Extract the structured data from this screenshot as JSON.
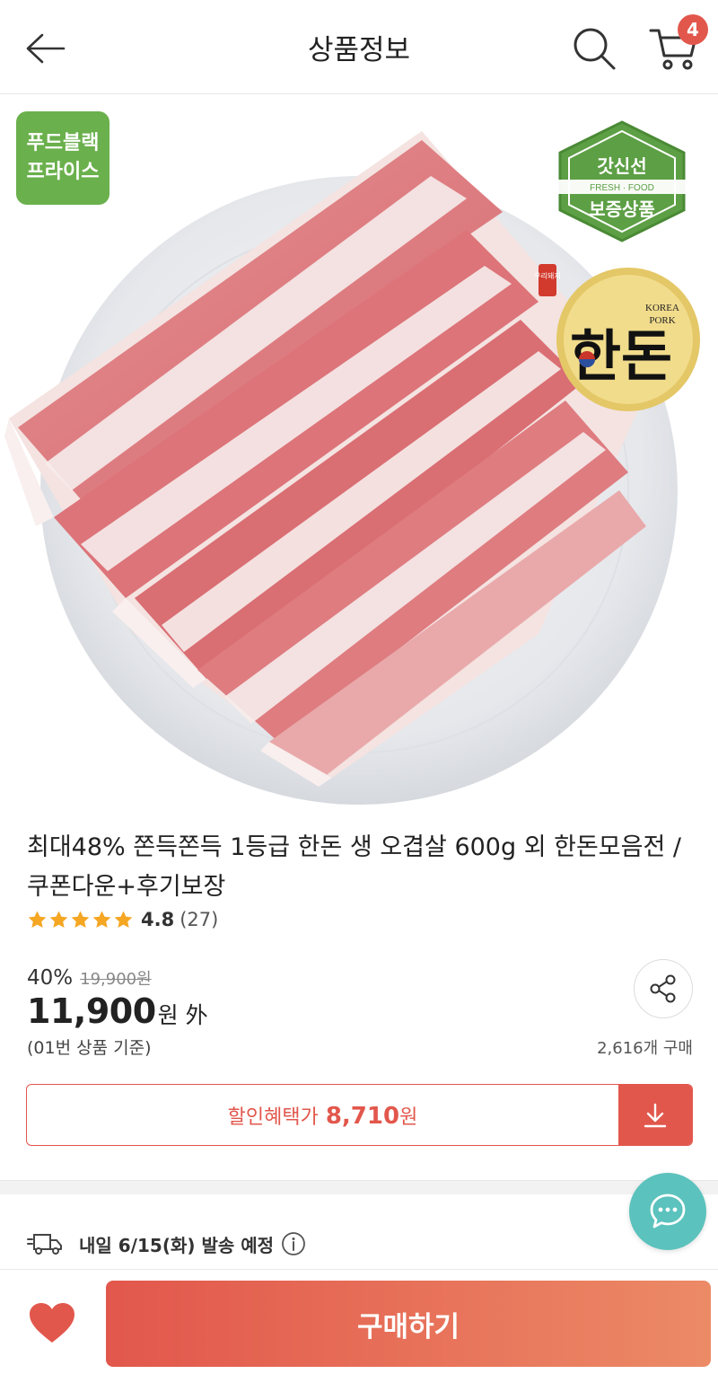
{
  "header": {
    "title": "상품정보",
    "cart_count": "4"
  },
  "image": {
    "badge_foodblack_line1": "푸드블랙",
    "badge_foodblack_line2": "프라이스",
    "badge_fresh_line1": "갓신선",
    "badge_fresh_line2": "보증상품",
    "badge_fresh_ribbon": "FRESH · FOOD",
    "badge_handon_tag": "우리돼지",
    "badge_handon_en1": "KOREA",
    "badge_handon_en2": "PORK",
    "badge_handon_logo": "한돈"
  },
  "product": {
    "title": "최대48% 쫀득쫀득 1등급 한돈 생 오겹살 600g 외 한돈모음전 /쿠폰다운+후기보장",
    "rating": "4.8",
    "review_count": "(27)",
    "stars": 5,
    "discount_rate": "40%",
    "original_price": "19,900원",
    "sale_price": "11,900",
    "price_unit": "원",
    "price_suffix": "外",
    "price_basis": "(01번 상품 기준)",
    "purchase_count": "2,616개 구매"
  },
  "coupon": {
    "label": "할인혜택가",
    "amount": "8,710",
    "unit": "원"
  },
  "shipping": {
    "text": "내일 6/15(화) 발송 예정"
  },
  "bottom": {
    "buy_label": "구매하기"
  },
  "colors": {
    "accent": "#e2574c",
    "chat": "#5bc2bd",
    "badge_green": "#6ab04c",
    "star": "#f5a623"
  }
}
